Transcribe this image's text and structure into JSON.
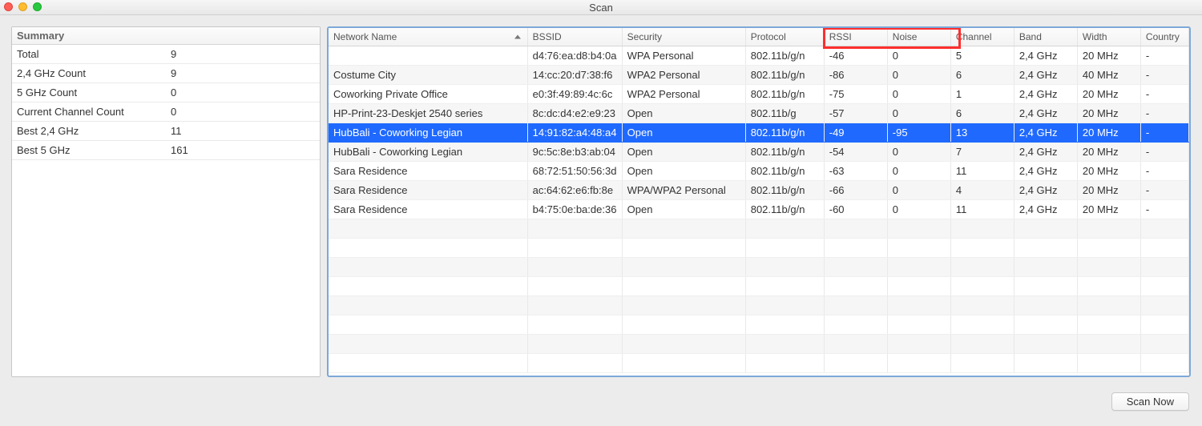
{
  "window": {
    "title": "Scan"
  },
  "summary": {
    "heading": "Summary",
    "rows": [
      {
        "label": "Total",
        "value": "9"
      },
      {
        "label": "2,4 GHz Count",
        "value": "9"
      },
      {
        "label": "5 GHz Count",
        "value": "0"
      },
      {
        "label": "Current Channel Count",
        "value": "0"
      },
      {
        "label": "Best 2,4 GHz",
        "value": "11"
      },
      {
        "label": "Best 5 GHz",
        "value": "161"
      }
    ]
  },
  "columns": {
    "name": "Network Name",
    "bssid": "BSSID",
    "security": "Security",
    "protocol": "Protocol",
    "rssi": "RSSI",
    "noise": "Noise",
    "channel": "Channel",
    "band": "Band",
    "width": "Width",
    "country": "Country"
  },
  "networks": [
    {
      "name": "",
      "bssid": "d4:76:ea:d8:b4:0a",
      "security": "WPA Personal",
      "protocol": "802.11b/g/n",
      "rssi": "-46",
      "noise": "0",
      "channel": "5",
      "band": "2,4 GHz",
      "width": "20 MHz",
      "country": "-"
    },
    {
      "name": "Costume City",
      "bssid": "14:cc:20:d7:38:f6",
      "security": "WPA2 Personal",
      "protocol": "802.11b/g/n",
      "rssi": "-86",
      "noise": "0",
      "channel": "6",
      "band": "2,4 GHz",
      "width": "40 MHz",
      "country": "-"
    },
    {
      "name": "Coworking Private Office",
      "bssid": "e0:3f:49:89:4c:6c",
      "security": "WPA2 Personal",
      "protocol": "802.11b/g/n",
      "rssi": "-75",
      "noise": "0",
      "channel": "1",
      "band": "2,4 GHz",
      "width": "20 MHz",
      "country": "-"
    },
    {
      "name": "HP-Print-23-Deskjet 2540 series",
      "bssid": "8c:dc:d4:e2:e9:23",
      "security": "Open",
      "protocol": "802.11b/g",
      "rssi": "-57",
      "noise": "0",
      "channel": "6",
      "band": "2,4 GHz",
      "width": "20 MHz",
      "country": "-"
    },
    {
      "name": "HubBali - Coworking Legian",
      "bssid": "14:91:82:a4:48:a4",
      "security": "Open",
      "protocol": "802.11b/g/n",
      "rssi": "-49",
      "noise": "-95",
      "channel": "13",
      "band": "2,4 GHz",
      "width": "20 MHz",
      "country": "-",
      "selected": true
    },
    {
      "name": "HubBali - Coworking Legian",
      "bssid": "9c:5c:8e:b3:ab:04",
      "security": "Open",
      "protocol": "802.11b/g/n",
      "rssi": "-54",
      "noise": "0",
      "channel": "7",
      "band": "2,4 GHz",
      "width": "20 MHz",
      "country": "-"
    },
    {
      "name": "Sara Residence",
      "bssid": "68:72:51:50:56:3d",
      "security": "Open",
      "protocol": "802.11b/g/n",
      "rssi": "-63",
      "noise": "0",
      "channel": "11",
      "band": "2,4 GHz",
      "width": "20 MHz",
      "country": "-"
    },
    {
      "name": "Sara Residence",
      "bssid": "ac:64:62:e6:fb:8e",
      "security": "WPA/WPA2 Personal",
      "protocol": "802.11b/g/n",
      "rssi": "-66",
      "noise": "0",
      "channel": "4",
      "band": "2,4 GHz",
      "width": "20 MHz",
      "country": "-"
    },
    {
      "name": "Sara Residence",
      "bssid": "b4:75:0e:ba:de:36",
      "security": "Open",
      "protocol": "802.11b/g/n",
      "rssi": "-60",
      "noise": "0",
      "channel": "11",
      "band": "2,4 GHz",
      "width": "20 MHz",
      "country": "-"
    }
  ],
  "buttons": {
    "scan_now": "Scan Now"
  }
}
